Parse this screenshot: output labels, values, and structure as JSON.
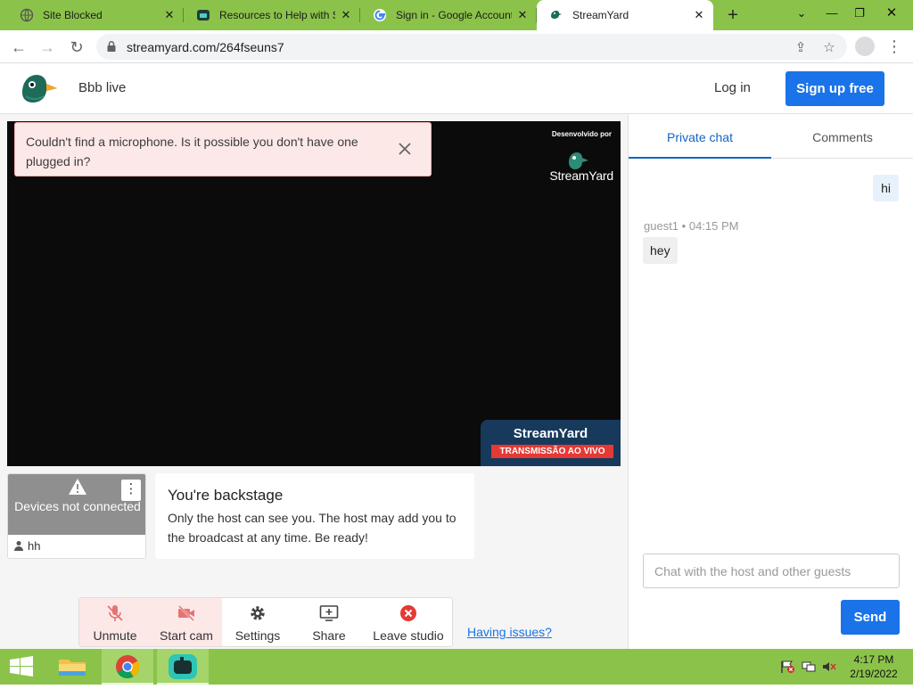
{
  "browser": {
    "tabs": [
      {
        "title": "Site Blocked",
        "active": false
      },
      {
        "title": "Resources to Help with St",
        "active": false
      },
      {
        "title": "Sign in - Google Account",
        "active": false
      },
      {
        "title": "StreamYard",
        "active": true
      }
    ],
    "url": "streamyard.com/264fseuns7"
  },
  "header": {
    "studio_name": "Bbb live",
    "login_label": "Log in",
    "signup_label": "Sign up free"
  },
  "stage": {
    "watermark_by": "Desenvolvido por",
    "watermark_name": "StreamYard",
    "badge_name": "StreamYard",
    "badge_live": "TRANSMISSÃO AO VIVO"
  },
  "alert": {
    "message": "Couldn't find a microphone. Is it possible you don't have one plugged in?"
  },
  "participant": {
    "status": "Devices not connected",
    "name": "hh"
  },
  "backstage": {
    "heading": "You're backstage",
    "text": "Only the host can see you. The host may add you to the broadcast at any time. Be ready!"
  },
  "controls": {
    "unmute": "Unmute",
    "start_cam": "Start cam",
    "settings": "Settings",
    "share": "Share",
    "leave": "Leave studio",
    "issues": "Having issues?"
  },
  "chat": {
    "tabs": [
      "Private chat",
      "Comments"
    ],
    "my_message": "hi",
    "guest_name": "guest1",
    "guest_time": "04:15 PM",
    "guest_message": "hey",
    "input_placeholder": "Chat with the host and other guests",
    "send_label": "Send"
  },
  "taskbar": {
    "time": "4:17 PM",
    "date": "2/19/2022"
  },
  "colors": {
    "accent": "#1a73e8",
    "chrome_frame": "#8bc34a",
    "alert_bg": "#fde8e8",
    "live_red": "#e53935"
  }
}
